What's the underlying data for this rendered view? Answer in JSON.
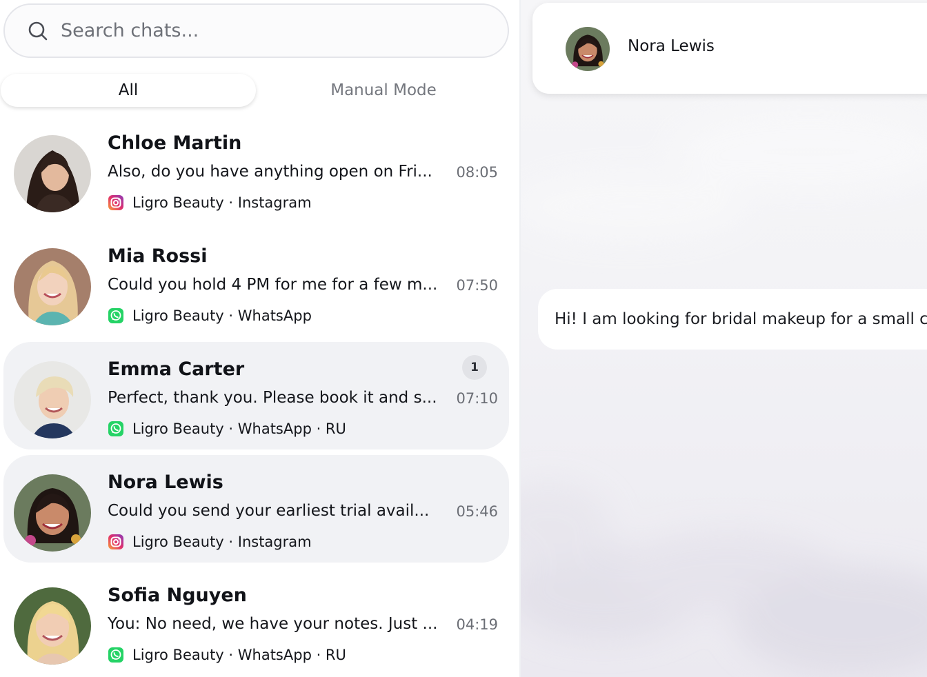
{
  "search": {
    "placeholder": "Search chats..."
  },
  "tabs": [
    {
      "label": "All",
      "active": true
    },
    {
      "label": "Manual Mode",
      "active": false
    }
  ],
  "chats": [
    {
      "name": "Chloe Martin",
      "preview": "Also, do you have anything open on Fri...",
      "time": "08:05",
      "channel_icon": "instagram-icon",
      "meta": "Ligro Beauty · Instagram",
      "unread": "",
      "highlighted": false
    },
    {
      "name": "Mia Rossi",
      "preview": "Could you hold 4 PM for me for a few m...",
      "time": "07:50",
      "channel_icon": "whatsapp-icon",
      "meta": "Ligro Beauty · WhatsApp",
      "unread": "",
      "highlighted": false
    },
    {
      "name": "Emma Carter",
      "preview": "Perfect, thank you. Please book it and s...",
      "time": "07:10",
      "channel_icon": "whatsapp-icon",
      "meta": "Ligro Beauty · WhatsApp · RU",
      "unread": "1",
      "highlighted": true
    },
    {
      "name": "Nora Lewis",
      "preview": "Could you send your earliest trial avail...",
      "time": "05:46",
      "channel_icon": "instagram-icon",
      "meta": "Ligro Beauty · Instagram",
      "unread": "",
      "highlighted": true
    },
    {
      "name": "Sofia Nguyen",
      "preview": "You: No need, we have your notes. Just ...",
      "time": "04:19",
      "channel_icon": "whatsapp-icon",
      "meta": "Ligro Beauty · WhatsApp · RU",
      "unread": "",
      "highlighted": false
    }
  ],
  "conversation": {
    "contact_name": "Nora Lewis",
    "messages": [
      {
        "text": "Hi! I am looking for bridal makeup for a small ceremony"
      }
    ]
  },
  "colors": {
    "highlight_row": "#f1f2f5",
    "whatsapp": "#25d366",
    "instagram_start": "#f9a13a",
    "instagram_end": "#c1359d"
  }
}
